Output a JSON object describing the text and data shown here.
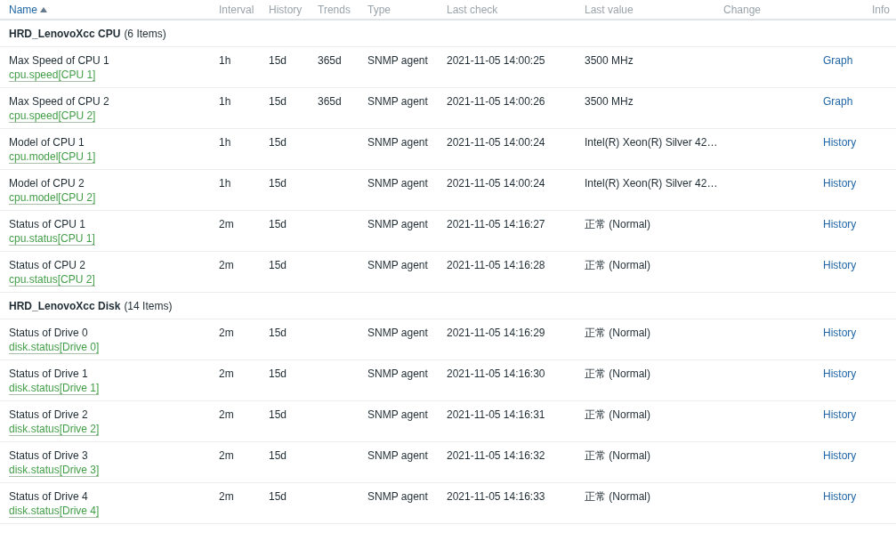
{
  "columns": [
    {
      "label": "Name",
      "sorted": true
    },
    {
      "label": "Interval",
      "sorted": false
    },
    {
      "label": "History",
      "sorted": false
    },
    {
      "label": "Trends",
      "sorted": false
    },
    {
      "label": "Type",
      "sorted": false
    },
    {
      "label": "Last check",
      "sorted": false
    },
    {
      "label": "Last value",
      "sorted": false
    },
    {
      "label": "Change",
      "sorted": false
    },
    {
      "label": "Info",
      "sorted": false
    }
  ],
  "groups": [
    {
      "name": "HRD_LenovoXcc CPU",
      "count": "(6 Items)",
      "items": [
        {
          "name": "Max Speed of CPU 1",
          "key": "cpu.speed[CPU 1]",
          "interval": "1h",
          "history": "15d",
          "trends": "365d",
          "type": "SNMP agent",
          "last_check": "2021-11-05 14:00:25",
          "last_value": "3500 MHz",
          "action": "Graph"
        },
        {
          "name": "Max Speed of CPU 2",
          "key": "cpu.speed[CPU 2]",
          "interval": "1h",
          "history": "15d",
          "trends": "365d",
          "type": "SNMP agent",
          "last_check": "2021-11-05 14:00:26",
          "last_value": "3500 MHz",
          "action": "Graph"
        },
        {
          "name": "Model of CPU 1",
          "key": "cpu.model[CPU 1]",
          "interval": "1h",
          "history": "15d",
          "type": "SNMP agent",
          "last_check": "2021-11-05 14:00:24",
          "last_value": "Intel(R) Xeon(R) Silver 42…",
          "action": "History"
        },
        {
          "name": "Model of CPU 2",
          "key": "cpu.model[CPU 2]",
          "interval": "1h",
          "history": "15d",
          "type": "SNMP agent",
          "last_check": "2021-11-05 14:00:24",
          "last_value": "Intel(R) Xeon(R) Silver 42…",
          "action": "History"
        },
        {
          "name": "Status of CPU 1",
          "key": "cpu.status[CPU 1]",
          "interval": "2m",
          "history": "15d",
          "type": "SNMP agent",
          "last_check": "2021-11-05 14:16:27",
          "last_value": "正常 (Normal)",
          "action": "History"
        },
        {
          "name": "Status of CPU 2",
          "key": "cpu.status[CPU 2]",
          "interval": "2m",
          "history": "15d",
          "type": "SNMP agent",
          "last_check": "2021-11-05 14:16:28",
          "last_value": "正常 (Normal)",
          "action": "History"
        }
      ]
    },
    {
      "name": "HRD_LenovoXcc Disk",
      "count": "(14 Items)",
      "items": [
        {
          "name": "Status of Drive 0",
          "key": "disk.status[Drive 0]",
          "interval": "2m",
          "history": "15d",
          "type": "SNMP agent",
          "last_check": "2021-11-05 14:16:29",
          "last_value": "正常 (Normal)",
          "action": "History"
        },
        {
          "name": "Status of Drive 1",
          "key": "disk.status[Drive 1]",
          "interval": "2m",
          "history": "15d",
          "type": "SNMP agent",
          "last_check": "2021-11-05 14:16:30",
          "last_value": "正常 (Normal)",
          "action": "History"
        },
        {
          "name": "Status of Drive 2",
          "key": "disk.status[Drive 2]",
          "interval": "2m",
          "history": "15d",
          "type": "SNMP agent",
          "last_check": "2021-11-05 14:16:31",
          "last_value": "正常 (Normal)",
          "action": "History"
        },
        {
          "name": "Status of Drive 3",
          "key": "disk.status[Drive 3]",
          "interval": "2m",
          "history": "15d",
          "type": "SNMP agent",
          "last_check": "2021-11-05 14:16:32",
          "last_value": "正常 (Normal)",
          "action": "History"
        },
        {
          "name": "Status of Drive 4",
          "key": "disk.status[Drive 4]",
          "interval": "2m",
          "history": "15d",
          "type": "SNMP agent",
          "last_check": "2021-11-05 14:16:33",
          "last_value": "正常 (Normal)",
          "action": "History"
        }
      ]
    }
  ]
}
